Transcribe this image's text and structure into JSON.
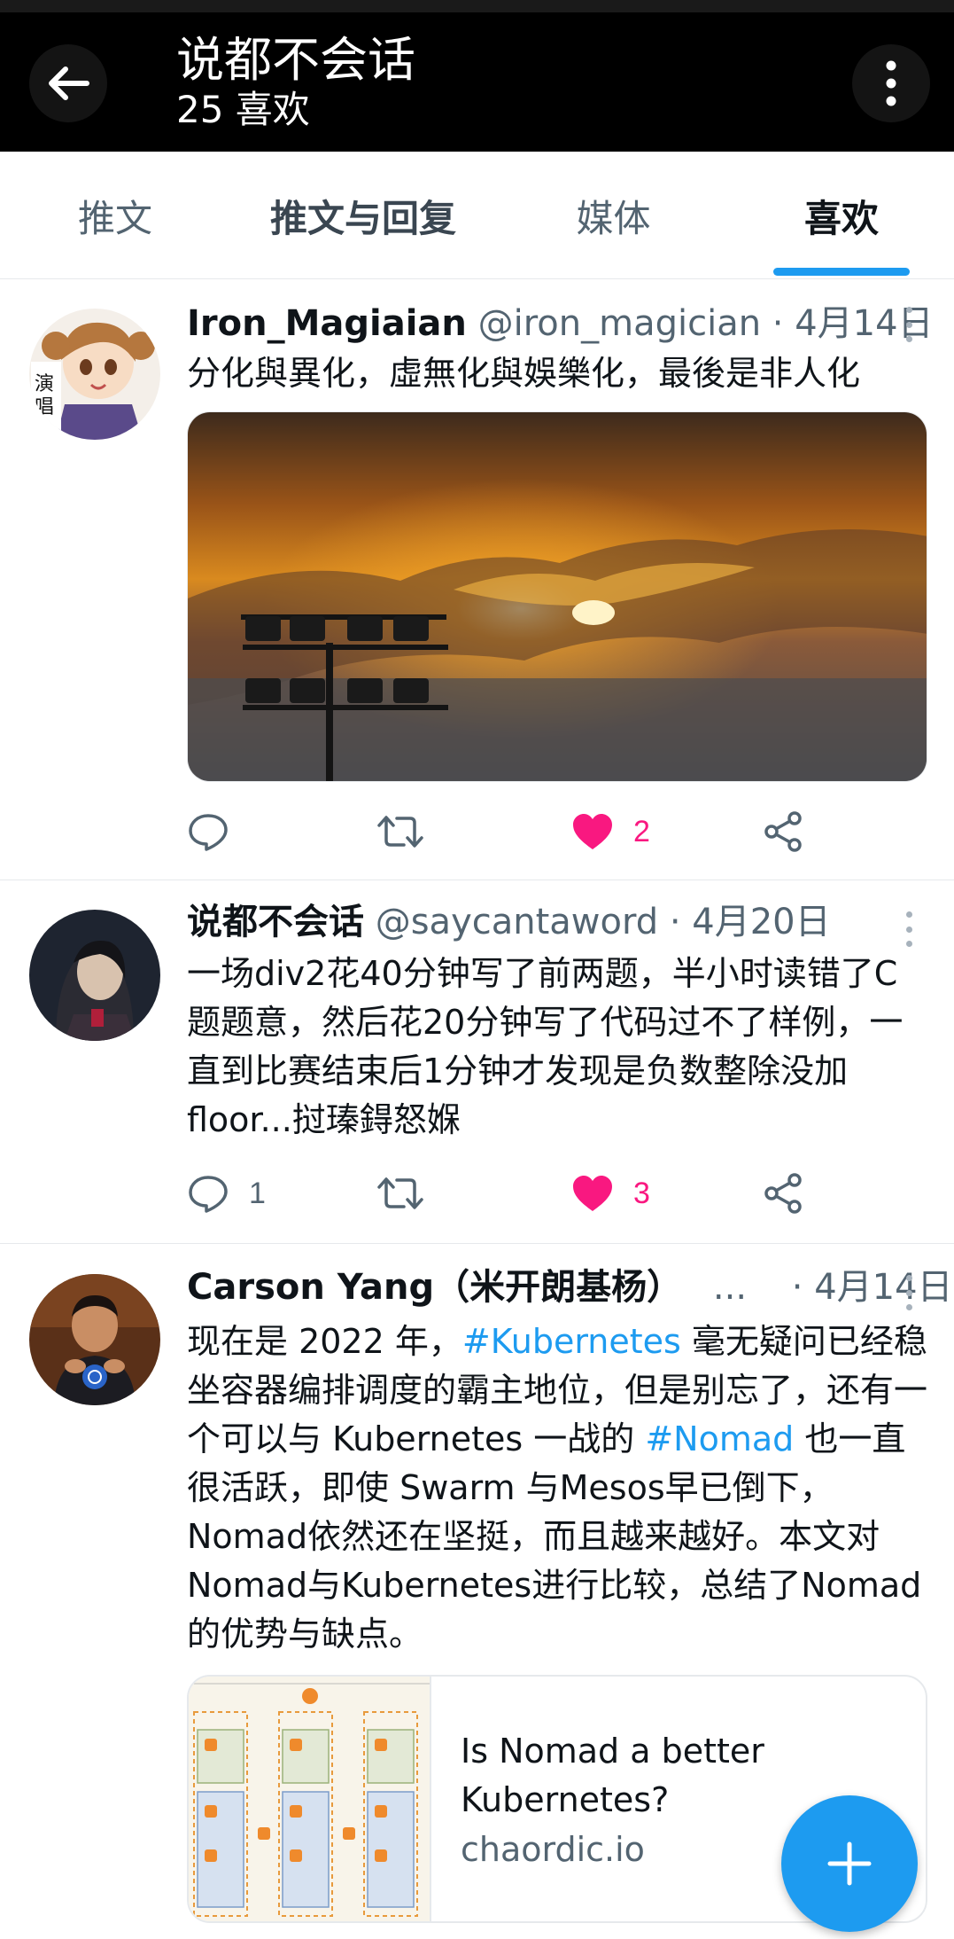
{
  "header": {
    "title": "说都不会话",
    "subtitle": "25 喜欢"
  },
  "tabs": [
    {
      "label": "推文",
      "active": false
    },
    {
      "label": "推文与回复",
      "active": false
    },
    {
      "label": "媒体",
      "active": false
    },
    {
      "label": "喜欢",
      "active": true
    }
  ],
  "tweets": [
    {
      "name": "Iron_Magiaian",
      "meta": "@iron_magician · 4月14日",
      "text": "分化與異化，虛無化與娛樂化，最後是非人化",
      "media": "sunset-photo",
      "replies": "",
      "retweets": "",
      "likes": "2",
      "liked": true
    },
    {
      "name": "说都不会话",
      "meta": "@saycantaword · 4月20日",
      "text": "一场div2花40分钟写了前两题，半小时读错了C题题意，然后花20分钟写了代码过不了样例，一直到比赛结束后1分钟才发现是负数整除没加floor...挝瑧鍀怒媬",
      "replies": "1",
      "retweets": "",
      "likes": "3",
      "liked": true
    },
    {
      "name": "Carson Yang（米开朗基杨）",
      "ellipsis": "...",
      "meta": "· 4月14日",
      "text_parts": [
        "现在是 2022 年，",
        "#Kubernetes",
        " 毫无疑问已经稳坐容器编排调度的霸主地位，但是别忘了，还有一个可以与 Kubernetes 一战的 ",
        "#Nomad",
        " 也一直很活跃，即使 Swarm 与Mesos早已倒下，Nomad依然还在坚挺，而且越来越好。本文对Nomad与Kubernetes进行比较，总结了Nomad 的优势与缺点。"
      ],
      "card": {
        "title": "Is Nomad a better Kubernetes?",
        "domain": "chaordic.io"
      }
    }
  ],
  "icons": {
    "back": "arrow-left-icon",
    "more": "more-vertical-icon",
    "reply": "reply-icon",
    "retweet": "retweet-icon",
    "like": "heart-icon",
    "share": "share-icon",
    "compose": "plus-icon"
  },
  "colors": {
    "accent": "#1d9bf0",
    "like": "#f91880",
    "header_bg": "#000000"
  }
}
